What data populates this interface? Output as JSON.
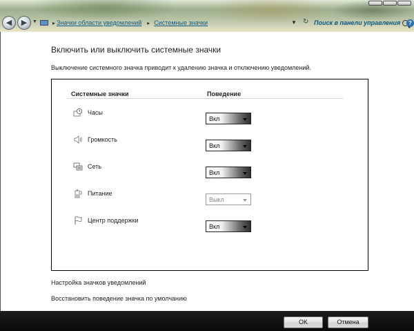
{
  "address_bar": {
    "breadcrumb": [
      "Значки области уведомлений",
      "Системные значки"
    ],
    "search_placeholder": "Поиск в панели управления"
  },
  "page": {
    "title": "Включить или выключить системные значки",
    "description": "Выключение системного значка приводит к удалению значка и отключению уведомлений."
  },
  "table": {
    "header_icons": "Системные значки",
    "header_behavior": "Поведение",
    "rows": [
      {
        "label": "Часы",
        "icon": "clock-icon",
        "value": "Вкл",
        "enabled": true
      },
      {
        "label": "Громкость",
        "icon": "volume-icon",
        "value": "Вкл",
        "enabled": true
      },
      {
        "label": "Сеть",
        "icon": "network-icon",
        "value": "Вкл",
        "enabled": true
      },
      {
        "label": "Питание",
        "icon": "power-icon",
        "value": "Выкл",
        "enabled": false
      },
      {
        "label": "Центр поддержки",
        "icon": "action-center-flag-icon",
        "value": "Вкл",
        "enabled": true
      }
    ]
  },
  "links": {
    "customize": "Настройка значков уведомлений",
    "restore": "Восстановить поведение значка по умолчанию"
  },
  "buttons": {
    "ok": "OK",
    "cancel": "Отмена"
  },
  "colors": {
    "link_blue": "#0d5a84",
    "bottom_bar": "#111111"
  }
}
